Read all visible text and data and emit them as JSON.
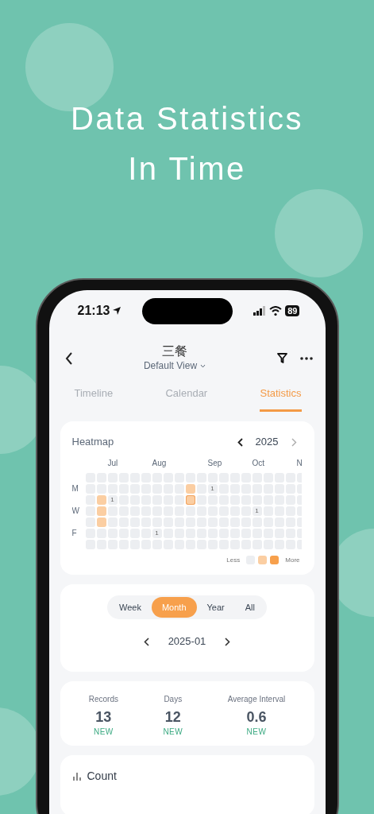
{
  "headline": [
    "Data Statistics",
    "In Time"
  ],
  "status_bar": {
    "time": "21:13",
    "battery": "89"
  },
  "header": {
    "title": "三餐",
    "view": "Default View"
  },
  "tabs": [
    {
      "label": "Timeline",
      "selected": false
    },
    {
      "label": "Calendar",
      "selected": false
    },
    {
      "label": "Statistics",
      "selected": true
    }
  ],
  "heatmap": {
    "title": "Heatmap",
    "year": "2025",
    "row_labels": [
      "M",
      "W",
      "F"
    ],
    "weeks": [
      {
        "days": [
          {
            "kind": "empty"
          },
          {
            "kind": "empty"
          },
          {
            "kind": "empty"
          },
          {
            "kind": "empty"
          },
          {
            "kind": "empty"
          },
          {
            "kind": "empty"
          },
          {
            "kind": "empty"
          }
        ]
      },
      {
        "days": [
          {
            "kind": "empty"
          },
          {
            "kind": "empty"
          },
          {
            "kind": "light"
          },
          {
            "kind": "light"
          },
          {
            "kind": "light"
          },
          {
            "kind": "empty"
          },
          {
            "kind": "empty"
          }
        ]
      },
      {
        "month": "Jul",
        "days": [
          {
            "kind": "empty"
          },
          {
            "kind": "empty"
          },
          {
            "kind": "empty",
            "count": "1"
          },
          {
            "kind": "empty"
          },
          {
            "kind": "empty"
          },
          {
            "kind": "empty"
          },
          {
            "kind": "empty"
          }
        ]
      },
      {
        "days": [
          {
            "kind": "empty"
          },
          {
            "kind": "empty"
          },
          {
            "kind": "empty"
          },
          {
            "kind": "empty"
          },
          {
            "kind": "empty"
          },
          {
            "kind": "empty"
          },
          {
            "kind": "empty"
          }
        ]
      },
      {
        "days": [
          {
            "kind": "empty"
          },
          {
            "kind": "empty"
          },
          {
            "kind": "empty"
          },
          {
            "kind": "empty"
          },
          {
            "kind": "empty"
          },
          {
            "kind": "empty"
          },
          {
            "kind": "empty"
          }
        ]
      },
      {
        "days": [
          {
            "kind": "empty"
          },
          {
            "kind": "empty"
          },
          {
            "kind": "empty"
          },
          {
            "kind": "empty"
          },
          {
            "kind": "empty"
          },
          {
            "kind": "empty"
          },
          {
            "kind": "empty"
          }
        ]
      },
      {
        "month": "Aug",
        "days": [
          {
            "kind": "empty"
          },
          {
            "kind": "empty"
          },
          {
            "kind": "empty"
          },
          {
            "kind": "empty"
          },
          {
            "kind": "empty"
          },
          {
            "kind": "empty",
            "count": "1"
          },
          {
            "kind": "empty"
          }
        ]
      },
      {
        "days": [
          {
            "kind": "empty"
          },
          {
            "kind": "empty"
          },
          {
            "kind": "empty"
          },
          {
            "kind": "empty"
          },
          {
            "kind": "empty"
          },
          {
            "kind": "empty"
          },
          {
            "kind": "empty"
          }
        ]
      },
      {
        "days": [
          {
            "kind": "empty"
          },
          {
            "kind": "empty"
          },
          {
            "kind": "empty"
          },
          {
            "kind": "empty"
          },
          {
            "kind": "empty"
          },
          {
            "kind": "empty"
          },
          {
            "kind": "empty"
          }
        ]
      },
      {
        "days": [
          {
            "kind": "empty"
          },
          {
            "kind": "light"
          },
          {
            "kind": "selected"
          },
          {
            "kind": "empty"
          },
          {
            "kind": "empty"
          },
          {
            "kind": "empty"
          },
          {
            "kind": "empty"
          }
        ]
      },
      {
        "days": [
          {
            "kind": "empty"
          },
          {
            "kind": "empty"
          },
          {
            "kind": "empty"
          },
          {
            "kind": "empty"
          },
          {
            "kind": "empty"
          },
          {
            "kind": "empty"
          },
          {
            "kind": "empty"
          }
        ]
      },
      {
        "month": "Sep",
        "days": [
          {
            "kind": "empty"
          },
          {
            "kind": "empty",
            "count": "1"
          },
          {
            "kind": "empty"
          },
          {
            "kind": "empty"
          },
          {
            "kind": "empty"
          },
          {
            "kind": "empty"
          },
          {
            "kind": "empty"
          }
        ]
      },
      {
        "days": [
          {
            "kind": "empty"
          },
          {
            "kind": "empty"
          },
          {
            "kind": "empty"
          },
          {
            "kind": "empty"
          },
          {
            "kind": "empty"
          },
          {
            "kind": "empty"
          },
          {
            "kind": "empty"
          }
        ]
      },
      {
        "days": [
          {
            "kind": "empty"
          },
          {
            "kind": "empty"
          },
          {
            "kind": "empty"
          },
          {
            "kind": "empty"
          },
          {
            "kind": "empty"
          },
          {
            "kind": "empty"
          },
          {
            "kind": "empty"
          }
        ]
      },
      {
        "days": [
          {
            "kind": "empty"
          },
          {
            "kind": "empty"
          },
          {
            "kind": "empty"
          },
          {
            "kind": "empty"
          },
          {
            "kind": "empty"
          },
          {
            "kind": "empty"
          },
          {
            "kind": "empty"
          }
        ]
      },
      {
        "month": "Oct",
        "days": [
          {
            "kind": "empty"
          },
          {
            "kind": "empty"
          },
          {
            "kind": "empty"
          },
          {
            "kind": "empty",
            "count": "1"
          },
          {
            "kind": "empty"
          },
          {
            "kind": "empty"
          },
          {
            "kind": "empty"
          }
        ]
      },
      {
        "days": [
          {
            "kind": "empty"
          },
          {
            "kind": "empty"
          },
          {
            "kind": "empty"
          },
          {
            "kind": "empty"
          },
          {
            "kind": "empty"
          },
          {
            "kind": "empty"
          },
          {
            "kind": "empty"
          }
        ]
      },
      {
        "days": [
          {
            "kind": "empty"
          },
          {
            "kind": "empty"
          },
          {
            "kind": "empty"
          },
          {
            "kind": "empty"
          },
          {
            "kind": "empty"
          },
          {
            "kind": "empty"
          },
          {
            "kind": "empty"
          }
        ]
      },
      {
        "days": [
          {
            "kind": "empty"
          },
          {
            "kind": "empty"
          },
          {
            "kind": "empty"
          },
          {
            "kind": "empty"
          },
          {
            "kind": "empty"
          },
          {
            "kind": "empty"
          },
          {
            "kind": "empty"
          }
        ]
      },
      {
        "month": "N",
        "days": [
          {
            "kind": "empty"
          },
          {
            "kind": "empty"
          },
          {
            "kind": "empty"
          },
          {
            "kind": "empty"
          },
          {
            "kind": "empty"
          },
          {
            "kind": "empty"
          },
          {
            "kind": "empty"
          }
        ]
      }
    ],
    "legend": {
      "less": "Less",
      "swatches": [
        {
          "kind": "empty"
        },
        {
          "kind": "light"
        },
        {
          "kind": "strong"
        }
      ],
      "more": "More"
    }
  },
  "periods": [
    {
      "label": "Week",
      "selected": false
    },
    {
      "label": "Month",
      "selected": true
    },
    {
      "label": "Year",
      "selected": false
    },
    {
      "label": "All",
      "selected": false
    }
  ],
  "period_value": "2025-01",
  "stats": [
    {
      "label": "Records",
      "value": "13",
      "badge": "NEW"
    },
    {
      "label": "Days",
      "value": "12",
      "badge": "NEW"
    },
    {
      "label": "Average Interval",
      "value": "0.6",
      "badge": "NEW"
    }
  ],
  "count_card": {
    "title": "Count"
  }
}
